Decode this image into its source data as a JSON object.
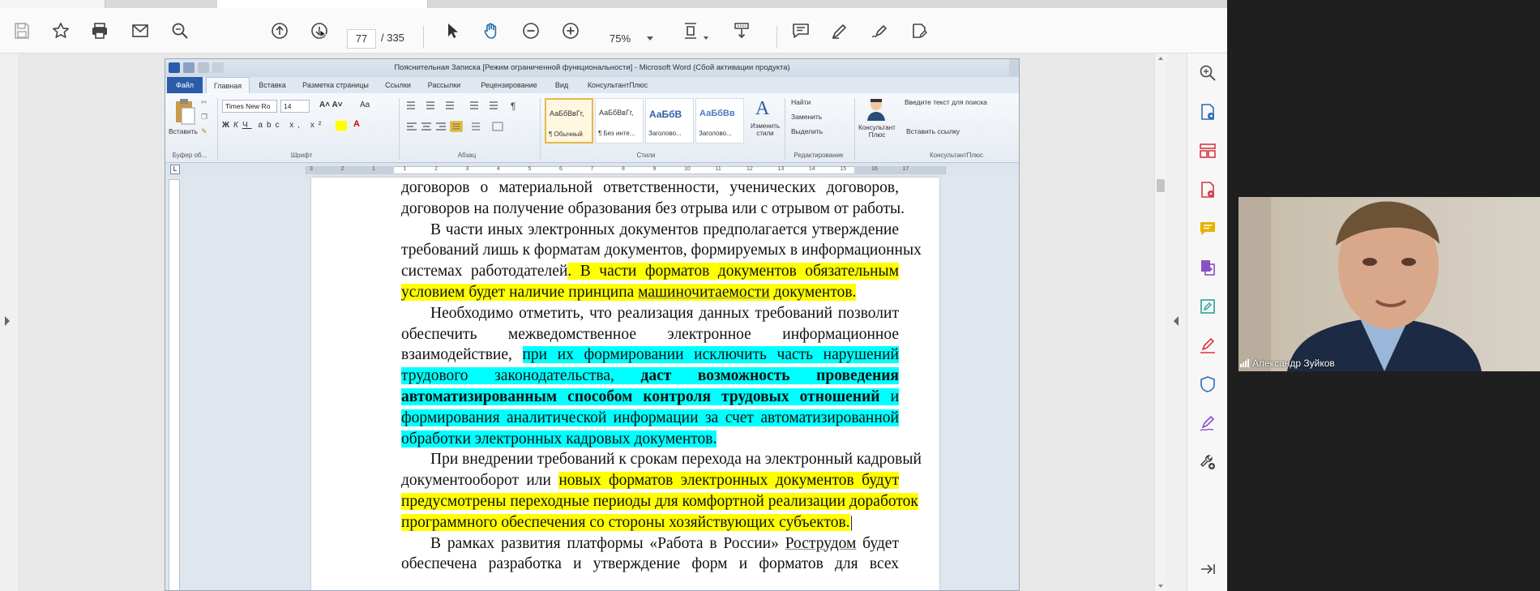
{
  "toolbar": {
    "page_current": "77",
    "page_total": "/ 335",
    "zoom": "75%"
  },
  "word": {
    "window_title": "Пояснительная Записка [Режим ограниченной функциональности] - Microsoft Word (Сбой активации продукта)",
    "tabs": [
      "Файл",
      "Главная",
      "Вставка",
      "Разметка страницы",
      "Ссылки",
      "Рассылки",
      "Рецензирование",
      "Вид",
      "КонсультантПлюс"
    ],
    "active_tab": "Главная",
    "clipboard": {
      "paste": "Вставить",
      "label": "Буфер об..."
    },
    "font": {
      "name": "Times New Ro",
      "size": "14",
      "label": "Шрифт"
    },
    "paragraph_label": "Абзац",
    "styles": [
      {
        "preview": "АаБбВвГг,",
        "name": "¶ Обычный"
      },
      {
        "preview": "АаБбВвГг,",
        "name": "¶ Без инте..."
      },
      {
        "preview": "АаБбВ",
        "name": "Заголово..."
      },
      {
        "preview": "АаБбВв",
        "name": "Заголово..."
      }
    ],
    "styles_label": "Стили",
    "change_styles": "Изменить стили",
    "editing": {
      "find": "Найти",
      "replace": "Заменить",
      "select": "Выделить",
      "label": "Редактирование"
    },
    "consultant": {
      "button": "Консультант Плюс",
      "search_placeholder": "Введите текст для поиска",
      "insert_link": "Вставить ссылку",
      "label": "КонсультантПлюс"
    },
    "corner": "L",
    "ruler_numbers": [
      "3",
      "2",
      "1",
      "1",
      "2",
      "3",
      "4",
      "5",
      "6",
      "7",
      "8",
      "9",
      "10",
      "11",
      "12",
      "13",
      "14",
      "15",
      "16",
      "17"
    ]
  },
  "document": {
    "lines": [
      {
        "indent": false,
        "last": false,
        "segs": [
          {
            "t": "договоров о материальной ответственности, ученических договоров,"
          }
        ]
      },
      {
        "indent": false,
        "last": true,
        "segs": [
          {
            "t": "договоров на получение образования без отрыва или с отрывом от работы."
          }
        ]
      },
      {
        "indent": true,
        "last": false,
        "segs": [
          {
            "t": "В части иных электронных документов предполагается утверждение"
          }
        ]
      },
      {
        "indent": false,
        "last": false,
        "segs": [
          {
            "t": "требований лишь к форматам документов, формируемых в информационных"
          }
        ]
      },
      {
        "indent": false,
        "last": false,
        "segs": [
          {
            "t": "системах работодателей"
          },
          {
            "t": ". В части форматов документов обязательным",
            "hl": "y"
          }
        ]
      },
      {
        "indent": false,
        "last": true,
        "segs": [
          {
            "t": "условием будет наличие принципа ",
            "hl": "y"
          },
          {
            "t": "машиночитаемости",
            "hl": "y",
            "u": true
          },
          {
            "t": " документов.",
            "hl": "y"
          }
        ]
      },
      {
        "indent": true,
        "last": false,
        "segs": [
          {
            "t": "Необходимо отметить, что реализация данных требований позволит"
          }
        ]
      },
      {
        "indent": false,
        "last": false,
        "segs": [
          {
            "t": "обеспечить межведомственное электронное информационное"
          }
        ]
      },
      {
        "indent": false,
        "last": false,
        "segs": [
          {
            "t": "взаимодействие, "
          },
          {
            "t": "при их формировании исключить часть нарушений",
            "hl": "c"
          }
        ]
      },
      {
        "indent": false,
        "last": false,
        "segs": [
          {
            "t": "трудового законодательства, ",
            "hl": "c"
          },
          {
            "t": "даст возможность проведения",
            "hl": "c",
            "b": true
          }
        ]
      },
      {
        "indent": false,
        "last": false,
        "segs": [
          {
            "t": "автоматизированным способом контроля трудовых отношений",
            "hl": "c",
            "b": true
          },
          {
            "t": " и",
            "hl": "c"
          }
        ]
      },
      {
        "indent": false,
        "last": false,
        "segs": [
          {
            "t": "формирования аналитической информации за счет автоматизированной",
            "hl": "c"
          }
        ]
      },
      {
        "indent": false,
        "last": true,
        "segs": [
          {
            "t": "обработки электронных кадровых документов.",
            "hl": "c"
          }
        ]
      },
      {
        "indent": true,
        "last": false,
        "segs": [
          {
            "t": "При внедрении требований к срокам перехода на электронный кадровый"
          }
        ]
      },
      {
        "indent": false,
        "last": false,
        "segs": [
          {
            "t": "документооборот или "
          },
          {
            "t": "новых форматов электронных документов будут",
            "hl": "y"
          }
        ]
      },
      {
        "indent": false,
        "last": false,
        "segs": [
          {
            "t": "предусмотрены переходные периоды для комфортной реализации доработок",
            "hl": "y"
          }
        ]
      },
      {
        "indent": false,
        "last": true,
        "segs": [
          {
            "t": "программного обеспечения со стороны хозяйствующих субъектов.",
            "hl": "y"
          },
          {
            "t": "|"
          }
        ]
      },
      {
        "indent": true,
        "last": false,
        "segs": [
          {
            "t": "В рамках развития платформы «Работа в России» "
          },
          {
            "t": "Рострудом",
            "u": true
          },
          {
            "t": " будет"
          }
        ]
      },
      {
        "indent": false,
        "last": false,
        "segs": [
          {
            "t": "обеспечена разработка и утверждение форм и форматов для всех"
          }
        ]
      }
    ]
  },
  "webcam": {
    "participant_name": "Александр Зуйков"
  },
  "colors": {
    "highlight_yellow": "#ffff00",
    "highlight_cyan": "#00ffff",
    "word_file_tab": "#2a5caa",
    "acrobat_icon_blue": "#2b6cb0",
    "acrobat_icon_red": "#d7373f",
    "acrobat_icon_purple": "#8c4fc4"
  }
}
